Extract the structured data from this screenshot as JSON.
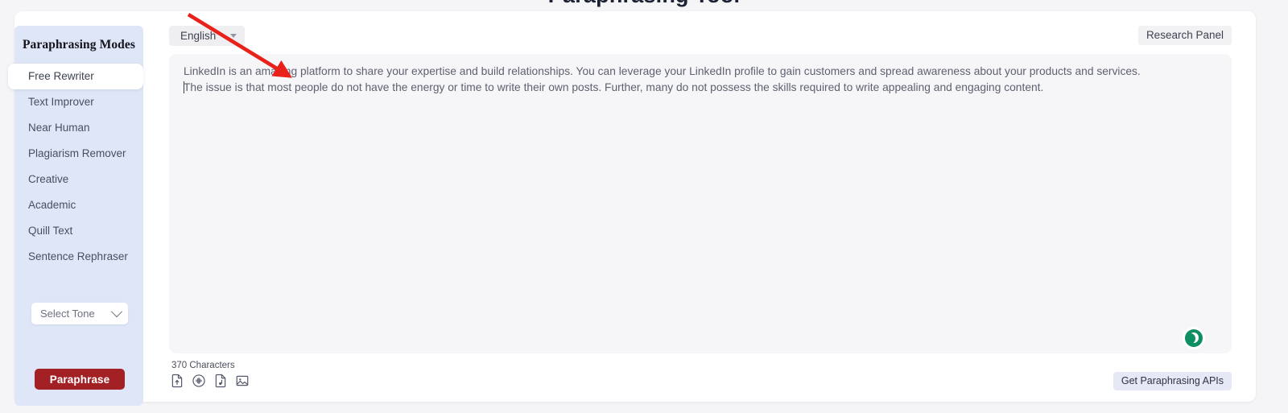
{
  "page": {
    "cut_off_heading": "Paraphrasing Tool"
  },
  "sidebar": {
    "title": "Paraphrasing Modes",
    "modes": [
      {
        "label": "Free Rewriter",
        "active": true
      },
      {
        "label": "Text Improver",
        "active": false
      },
      {
        "label": "Near Human",
        "active": false
      },
      {
        "label": "Plagiarism Remover",
        "active": false
      },
      {
        "label": "Creative",
        "active": false
      },
      {
        "label": "Academic",
        "active": false
      },
      {
        "label": "Quill Text",
        "active": false
      },
      {
        "label": "Sentence Rephraser",
        "active": false
      }
    ],
    "tone_select": {
      "value": "Select Tone",
      "icon": "chevron-down-icon"
    },
    "paraphrase_button": {
      "label": "Paraphrase",
      "color": "#a32025"
    }
  },
  "toolbar": {
    "language": {
      "value": "English",
      "icon": "caret-down-icon"
    },
    "research_panel_label": "Research Panel"
  },
  "editor": {
    "line1": "LinkedIn is an amazing platform to share your expertise and build relationships. You can leverage your LinkedIn profile to gain customers and spread awareness about your products and services.",
    "line2": "The issue is that most people do not have the energy or time to write their own posts. Further, many do not possess the skills required to write appealing and engaging content.",
    "character_count": "370 Characters",
    "dark_mode_badge": {
      "icon": "moon-icon",
      "color": "#0e8e63"
    }
  },
  "attachments": [
    {
      "icon": "upload-document-icon",
      "name": "upload-document"
    },
    {
      "icon": "audio-waveform-icon",
      "name": "speech-to-text"
    },
    {
      "icon": "audio-file-icon",
      "name": "audio-file"
    },
    {
      "icon": "image-icon",
      "name": "image-to-text"
    }
  ],
  "footer": {
    "get_apis_label": "Get Paraphrasing APIs"
  },
  "annotation": {
    "arrow_color": "#e8221a"
  }
}
